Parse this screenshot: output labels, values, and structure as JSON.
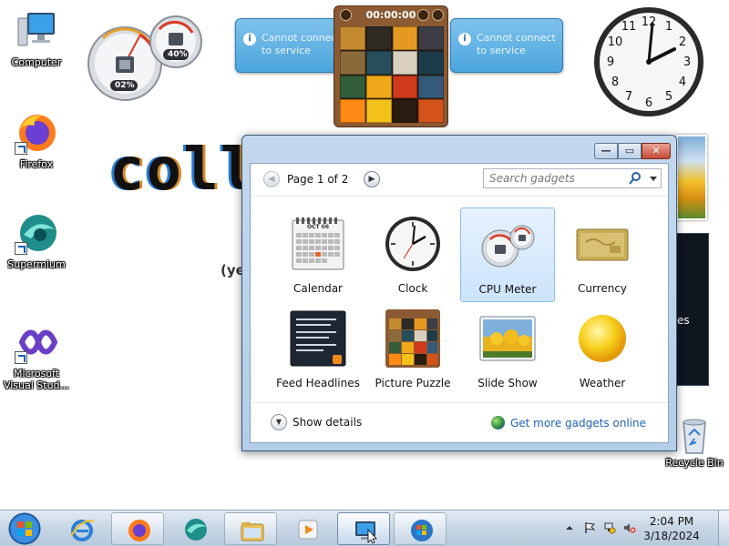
{
  "desktop": {
    "icons": [
      {
        "label": "Computer"
      },
      {
        "label": "Firefox"
      },
      {
        "label": "Supermium"
      },
      {
        "label": "Microsoft Visual Stud..."
      }
    ],
    "background_text": "colla",
    "background_sub": "(ye",
    "background_dark_text": "es",
    "recycle_bin": "Recycle Bin"
  },
  "widgets": {
    "cpu_percent": "02%",
    "memory_percent": "40%",
    "message_left": "Cannot connect to service",
    "message_right": "Cannot connect to service",
    "puzzle_timer": "00:00:00"
  },
  "gallery": {
    "page_label": "Page 1 of 2",
    "search_placeholder": "Search gadgets",
    "gadgets": [
      {
        "name": "Calendar",
        "selected": false
      },
      {
        "name": "Clock",
        "selected": false
      },
      {
        "name": "CPU Meter",
        "selected": true
      },
      {
        "name": "Currency",
        "selected": false
      },
      {
        "name": "Feed Headlines",
        "selected": false
      },
      {
        "name": "Picture Puzzle",
        "selected": false
      },
      {
        "name": "Slide Show",
        "selected": false
      },
      {
        "name": "Weather",
        "selected": false
      }
    ],
    "calendar_month": "OCT 06",
    "show_details": "Show details",
    "get_more": "Get more gadgets online"
  },
  "taskbar": {
    "time": "2:04 PM",
    "date": "3/18/2024"
  },
  "colors": {
    "selection": "#cde4fb",
    "link": "#1c62b8",
    "close_button": "#c54b36"
  }
}
